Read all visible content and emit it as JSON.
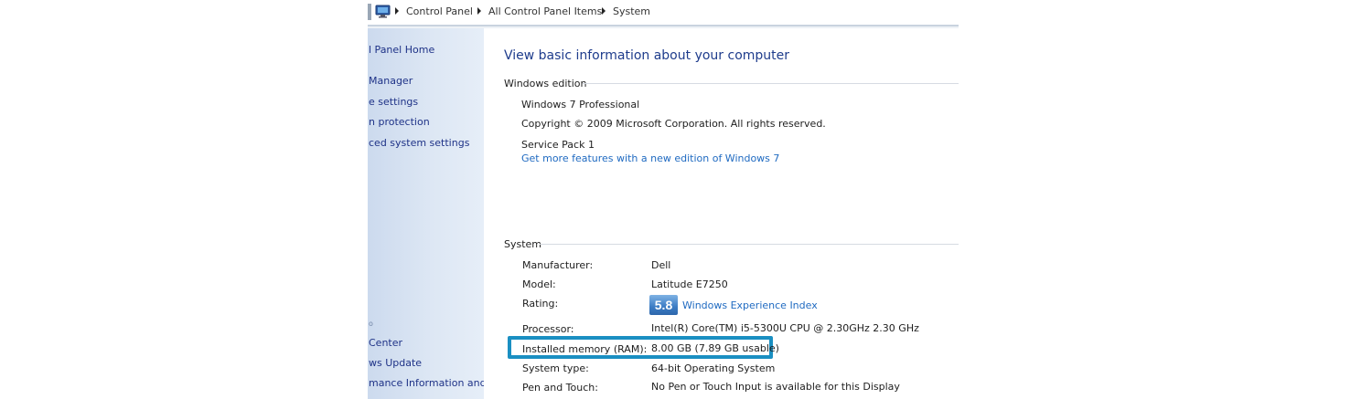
{
  "breadcrumb": {
    "items": [
      "Control Panel",
      "All Control Panel Items",
      "System"
    ]
  },
  "nav": {
    "items": [
      "l Panel Home",
      "Manager",
      "e settings",
      "n protection",
      "ced system settings"
    ],
    "see_also_label": "o",
    "see_also_items": [
      "Center",
      "ws Update",
      "mance Information and"
    ]
  },
  "main": {
    "title": "View basic information about your computer",
    "edition": {
      "heading": "Windows edition",
      "name": "Windows 7 Professional",
      "copyright": "Copyright © 2009 Microsoft Corporation.  All rights reserved.",
      "service_pack": "Service Pack 1",
      "upgrade_link": "Get more features with a new edition of Windows 7"
    },
    "system": {
      "heading": "System",
      "manufacturer_label": "Manufacturer:",
      "manufacturer_value": "Dell",
      "model_label": "Model:",
      "model_value": "Latitude E7250",
      "rating_label": "Rating:",
      "rating_score": "5.8",
      "rating_link": "Windows Experience Index",
      "processor_label": "Processor:",
      "processor_value": "Intel(R) Core(TM) i5-5300U CPU @ 2.30GHz   2.30 GHz",
      "memory_label": "Installed memory (RAM):",
      "memory_value": "8.00 GB (7.89 GB usable)",
      "system_type_label": "System type:",
      "system_type_value": "64-bit Operating System",
      "pen_touch_label": "Pen and Touch:",
      "pen_touch_value": "No Pen or Touch Input is available for this Display"
    }
  },
  "colors": {
    "title_blue": "#1e3c8c",
    "link_blue": "#1f6ac1",
    "highlight_box": "#1a8fc2",
    "nav_bg": "#dde7f4"
  },
  "icons": {
    "address": "computer-icon",
    "breadcrumb_separator": "chevron-right-icon"
  }
}
